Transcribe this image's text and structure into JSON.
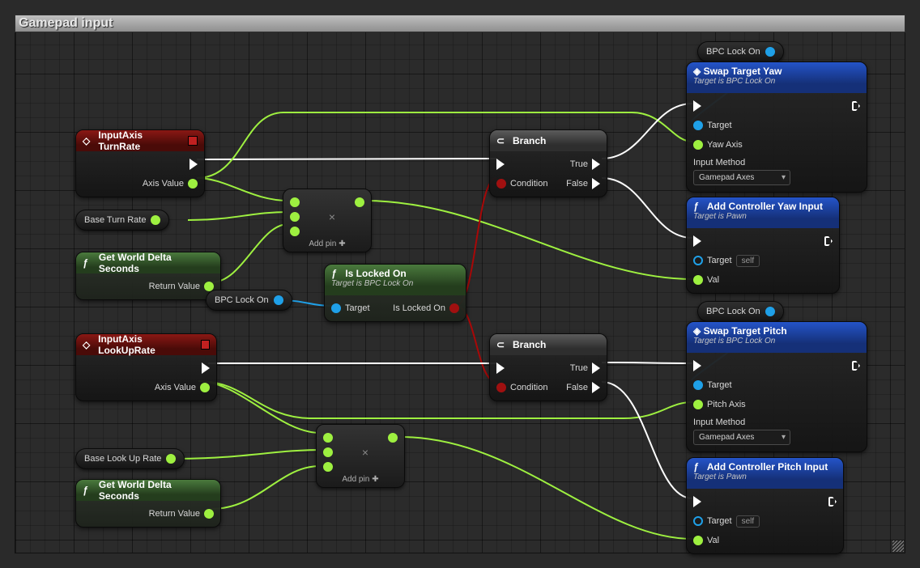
{
  "title": "Gamepad input",
  "nodes": {
    "inputAxisTurn": {
      "title": "InputAxis TurnRate",
      "axisValue": "Axis Value"
    },
    "inputAxisLookUp": {
      "title": "InputAxis LookUpRate",
      "axisValue": "Axis Value"
    },
    "baseTurnRate": {
      "label": "Base Turn Rate"
    },
    "baseLookUpRate": {
      "label": "Base Look Up Rate"
    },
    "getWorldDelta": {
      "title": "Get World Delta Seconds",
      "returnValue": "Return Value"
    },
    "bpcLockOn": {
      "label": "BPC Lock On"
    },
    "isLockedOn": {
      "title": "Is Locked On",
      "subtitle": "Target is BPC Lock On",
      "target": "Target",
      "out": "Is Locked On"
    },
    "branch": {
      "title": "Branch",
      "condition": "Condition",
      "true": "True",
      "false": "False"
    },
    "swapYaw": {
      "title": "Swap Target Yaw",
      "subtitle": "Target is BPC Lock On",
      "target": "Target",
      "yaw": "Yaw Axis",
      "inputMethod": "Input Method",
      "inputMethodValue": "Gamepad Axes"
    },
    "swapPitch": {
      "title": "Swap Target Pitch",
      "subtitle": "Target is BPC Lock On",
      "target": "Target",
      "pitch": "Pitch Axis",
      "inputMethod": "Input Method",
      "inputMethodValue": "Gamepad Axes"
    },
    "addYaw": {
      "title": "Add Controller Yaw Input",
      "subtitle": "Target is Pawn",
      "target": "Target",
      "val": "Val",
      "self": "self"
    },
    "addPitch": {
      "title": "Add Controller Pitch Input",
      "subtitle": "Target is Pawn",
      "target": "Target",
      "val": "Val",
      "self": "self"
    },
    "math": {
      "addPin": "Add pin"
    }
  }
}
